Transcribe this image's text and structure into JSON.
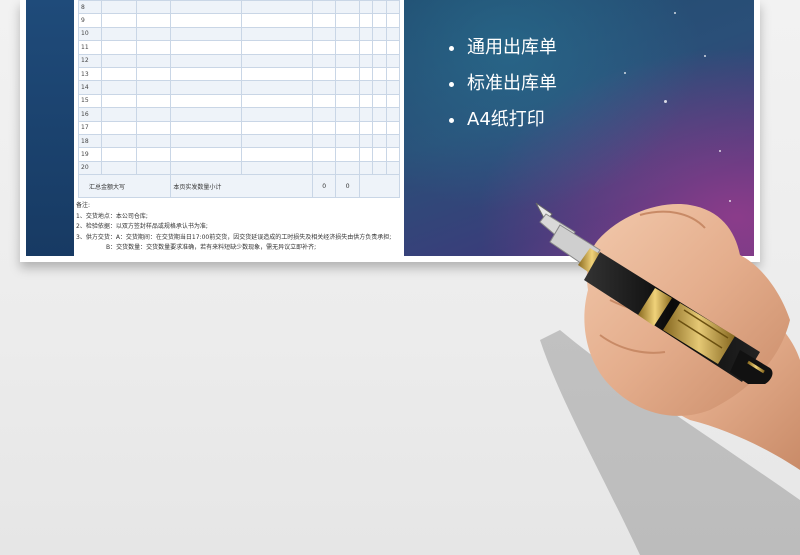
{
  "table": {
    "row_numbers": [
      "8",
      "9",
      "10",
      "11",
      "12",
      "13",
      "14",
      "15",
      "16",
      "17",
      "18",
      "19",
      "20"
    ],
    "total_label": "汇总金额大写",
    "subtotal_label": "本页实发数量小计",
    "subtotal_values": [
      "0",
      "0"
    ]
  },
  "notes": {
    "title": "备注:",
    "lines": [
      "1、交货地点：本公司仓库;",
      "2、检验依据：以双方签封样品或规格承认书为准;",
      "3、供方交货：A：交货期间：在交货期当日17:00前交货，因交货延误造成的工时损失及相关经济损失由供方负责承担;",
      "B：交货数量：交货数量要求准确，若有来料短缺少数现象，需无异议立即补齐;"
    ]
  },
  "slide": {
    "bullets": [
      "通用出库单",
      "标准出库单",
      "A4纸打印"
    ]
  },
  "colors": {
    "sheet_border": "#c9d6e6",
    "frame_blue": "#1d4470",
    "bullet_text": "#ffffff"
  }
}
